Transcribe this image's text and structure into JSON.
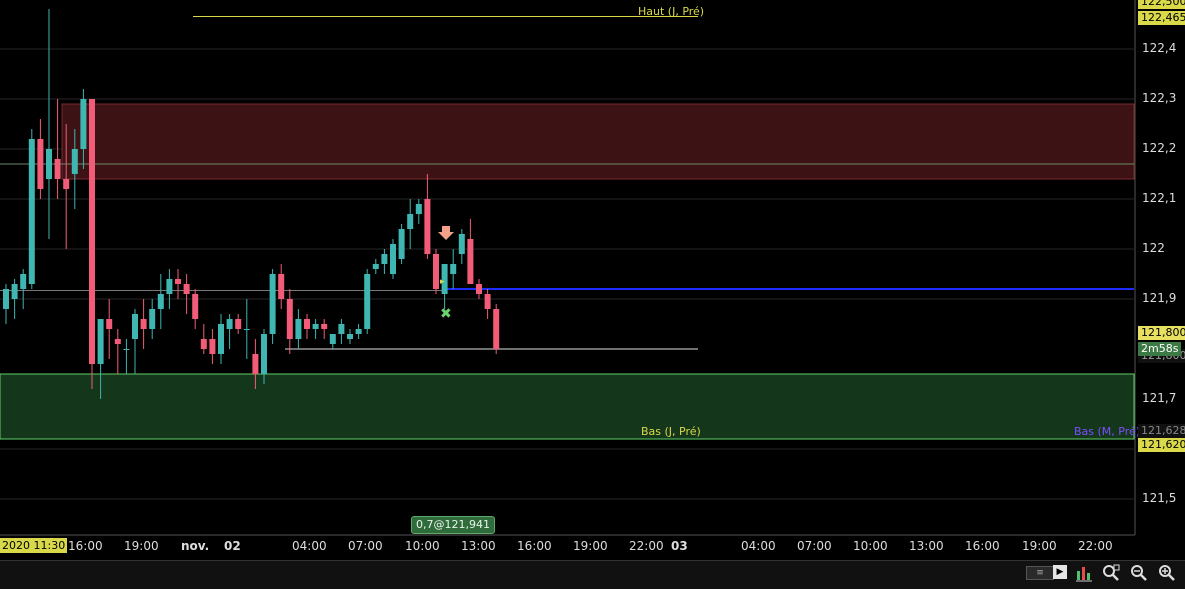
{
  "app": {
    "start_label": "2020 11:30",
    "cursor_badge": "0,7@121,941"
  },
  "colors": {
    "bull": "#3fb6b1",
    "bear": "#f25c78",
    "resistance_zone": "#3d1214",
    "support_zone": "#14361a",
    "blue_line": "#1d2cff"
  },
  "levels": {
    "haut": {
      "label": "Haut (J, Pré)",
      "price_tag": "122,465",
      "color": "#d9d94a"
    },
    "bas": {
      "label": "Bas (J, Pré)",
      "price_tag": "121,620",
      "color": "#d9d94a"
    },
    "bas_m": {
      "label": "Bas (M, Pré)",
      "color": "#7b4fff"
    },
    "top_tag": "122,500",
    "current_price": "121,800",
    "countdown": "2m58s",
    "support_tag": "121,800",
    "lower_tag": "121,628"
  },
  "toolbar": {
    "scroll_label": "≡",
    "scroll_right_label": "▶"
  },
  "icons": [
    "chart-type-icon",
    "zoom-auto-icon",
    "zoom-out-icon",
    "zoom-in-icon"
  ],
  "chart_data": {
    "type": "candlestick",
    "ylim": [
      121.42,
      122.53
    ],
    "y_ticks": [
      "122,4",
      "122,3",
      "122,2",
      "122,1",
      "122",
      "121,9",
      "121,7",
      "121,5"
    ],
    "y_tick_values": [
      122.4,
      122.3,
      122.2,
      122.1,
      122.0,
      121.9,
      121.7,
      121.5
    ],
    "x_ticks": [
      "16:00",
      "19:00",
      "nov.",
      "02",
      "04:00",
      "07:00",
      "10:00",
      "13:00",
      "16:00",
      "19:00",
      "22:00",
      "03",
      "04:00",
      "07:00",
      "10:00",
      "13:00",
      "16:00",
      "19:00",
      "22:00"
    ],
    "zones": [
      {
        "name": "resistance",
        "from": 122.14,
        "to": 122.29
      },
      {
        "name": "support",
        "from": 121.62,
        "to": 121.75
      }
    ],
    "lines": [
      {
        "name": "haut",
        "value": 122.465
      },
      {
        "name": "gray-1",
        "value": 122.17
      },
      {
        "name": "gray-2",
        "value": 121.917
      },
      {
        "name": "blue",
        "value": 121.92
      },
      {
        "name": "white",
        "value": 121.8
      },
      {
        "name": "bas",
        "value": 121.62
      }
    ],
    "candles": [
      [
        121.88,
        121.93,
        121.85,
        121.92
      ],
      [
        121.9,
        121.94,
        121.86,
        121.93
      ],
      [
        121.92,
        121.96,
        121.88,
        121.95
      ],
      [
        121.93,
        122.24,
        121.92,
        122.22
      ],
      [
        122.22,
        122.26,
        122.1,
        122.12
      ],
      [
        122.14,
        122.48,
        122.02,
        122.2
      ],
      [
        122.18,
        122.3,
        122.1,
        122.14
      ],
      [
        122.14,
        122.25,
        122.0,
        122.12
      ],
      [
        122.15,
        122.24,
        122.08,
        122.2
      ],
      [
        122.2,
        122.32,
        122.16,
        122.3
      ],
      [
        122.3,
        122.3,
        121.72,
        121.77
      ],
      [
        121.77,
        121.86,
        121.7,
        121.86
      ],
      [
        121.86,
        121.9,
        121.78,
        121.84
      ],
      [
        121.82,
        121.84,
        121.75,
        121.81
      ],
      [
        121.8,
        121.82,
        121.75,
        121.8
      ],
      [
        121.82,
        121.88,
        121.75,
        121.87
      ],
      [
        121.86,
        121.9,
        121.8,
        121.84
      ],
      [
        121.84,
        121.9,
        121.82,
        121.88
      ],
      [
        121.88,
        121.95,
        121.84,
        121.91
      ],
      [
        121.91,
        121.96,
        121.88,
        121.94
      ],
      [
        121.94,
        121.96,
        121.9,
        121.93
      ],
      [
        121.93,
        121.95,
        121.87,
        121.91
      ],
      [
        121.91,
        121.92,
        121.84,
        121.86
      ],
      [
        121.82,
        121.85,
        121.79,
        121.8
      ],
      [
        121.82,
        121.84,
        121.77,
        121.79
      ],
      [
        121.79,
        121.87,
        121.77,
        121.85
      ],
      [
        121.84,
        121.87,
        121.8,
        121.86
      ],
      [
        121.86,
        121.87,
        121.83,
        121.84
      ],
      [
        121.84,
        121.9,
        121.78,
        121.84
      ],
      [
        121.79,
        121.82,
        121.72,
        121.75
      ],
      [
        121.75,
        121.84,
        121.73,
        121.83
      ],
      [
        121.83,
        121.96,
        121.81,
        121.95
      ],
      [
        121.95,
        121.97,
        121.88,
        121.9
      ],
      [
        121.9,
        121.92,
        121.79,
        121.82
      ],
      [
        121.82,
        121.88,
        121.8,
        121.86
      ],
      [
        121.86,
        121.87,
        121.82,
        121.84
      ],
      [
        121.84,
        121.86,
        121.82,
        121.85
      ],
      [
        121.85,
        121.86,
        121.82,
        121.84
      ],
      [
        121.81,
        121.83,
        121.8,
        121.83
      ],
      [
        121.83,
        121.86,
        121.81,
        121.85
      ],
      [
        121.82,
        121.84,
        121.81,
        121.83
      ],
      [
        121.83,
        121.85,
        121.82,
        121.84
      ],
      [
        121.84,
        121.96,
        121.83,
        121.95
      ],
      [
        121.96,
        121.98,
        121.95,
        121.97
      ],
      [
        121.97,
        122.0,
        121.95,
        121.99
      ],
      [
        121.95,
        122.02,
        121.94,
        122.01
      ],
      [
        121.98,
        122.05,
        121.97,
        122.04
      ],
      [
        122.04,
        122.1,
        122.0,
        122.07
      ],
      [
        122.07,
        122.1,
        122.05,
        122.09
      ],
      [
        122.1,
        122.15,
        121.98,
        121.99
      ],
      [
        121.99,
        122.0,
        121.91,
        121.92
      ],
      [
        121.91,
        121.97,
        121.88,
        121.97
      ],
      [
        121.95,
        122.0,
        121.92,
        121.97
      ],
      [
        121.99,
        122.04,
        121.97,
        122.03
      ],
      [
        122.02,
        122.06,
        121.93,
        121.93
      ],
      [
        121.93,
        121.94,
        121.9,
        121.91
      ],
      [
        121.91,
        121.92,
        121.86,
        121.88
      ],
      [
        121.88,
        121.89,
        121.79,
        121.8
      ]
    ]
  }
}
